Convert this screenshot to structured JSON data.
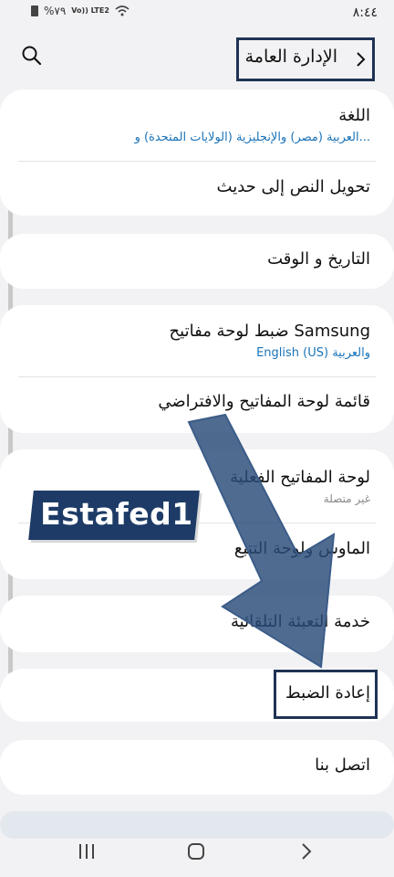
{
  "status": {
    "time": "٨:٤٤",
    "battery": "%٧٩",
    "network": "Vo)) LTE2"
  },
  "header": {
    "title": "الإدارة العامة"
  },
  "items": [
    {
      "title": "اللغة",
      "subtitle": "العربية (مصر) والإنجليزية (الولايات المتحدة) و..."
    },
    {
      "title": "تحويل النص إلى حديث"
    },
    {
      "title": "التاريخ و الوقت"
    },
    {
      "title": "ضبط لوحة مفاتيح Samsung",
      "subtitle": "English (US) والعربية"
    },
    {
      "title": "قائمة لوحة المفاتيح والافتراضي"
    },
    {
      "title": "لوحة المفاتيح الفعلية",
      "status": "غير متصلة"
    },
    {
      "title": "الماوس ولوحة التتبع"
    },
    {
      "title": "خدمة التعبئة التلقائية"
    },
    {
      "title": "إعادة الضبط"
    },
    {
      "title": "اتصل بنا"
    }
  ],
  "watermark": "Estafed1",
  "colors": {
    "accent": "#1f3354",
    "link": "#1a73b8",
    "arrow": "#2a4b78"
  },
  "icons": [
    "search-icon",
    "back-chevron-icon",
    "recent-apps-icon",
    "home-icon",
    "back-nav-icon"
  ]
}
